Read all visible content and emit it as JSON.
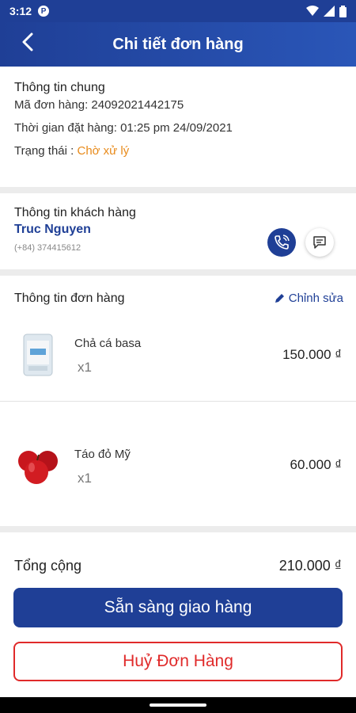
{
  "status_bar": {
    "time": "3:12",
    "notif_letter": "P"
  },
  "header": {
    "title": "Chi tiết đơn hàng"
  },
  "general_info": {
    "title": "Thông tin chung",
    "order_code": "Mã đơn hàng: 24092021442175",
    "order_time": "Thời gian đặt hàng: 01:25 pm 24/09/2021",
    "status_label": "Trạng thái : ",
    "status_value": "Chờ xử lý"
  },
  "customer": {
    "title": "Thông tin khách hàng",
    "name": "Truc Nguyen",
    "phone": "(+84) 374415612"
  },
  "order": {
    "title": "Thông tin đơn hàng",
    "edit_label": "Chỉnh sửa",
    "items": [
      {
        "name": "Chả cá basa",
        "qty": "x1",
        "price": "150.000 ₫"
      },
      {
        "name": "Táo đỏ Mỹ",
        "qty": "x1",
        "price": "60.000 ₫"
      }
    ]
  },
  "footer": {
    "total_label": "Tổng cộng",
    "total_value": "210.000 ₫",
    "ready_button": "Sẵn sàng giao hàng",
    "cancel_button": "Huỷ Đơn Hàng"
  },
  "colors": {
    "primary": "#1f3f96",
    "status": "#e88a1a",
    "danger": "#e02a2a"
  },
  "icons": [
    "back-arrow-icon",
    "phone-icon",
    "chat-icon",
    "pencil-icon",
    "wifi-icon",
    "signal-icon",
    "battery-icon"
  ]
}
